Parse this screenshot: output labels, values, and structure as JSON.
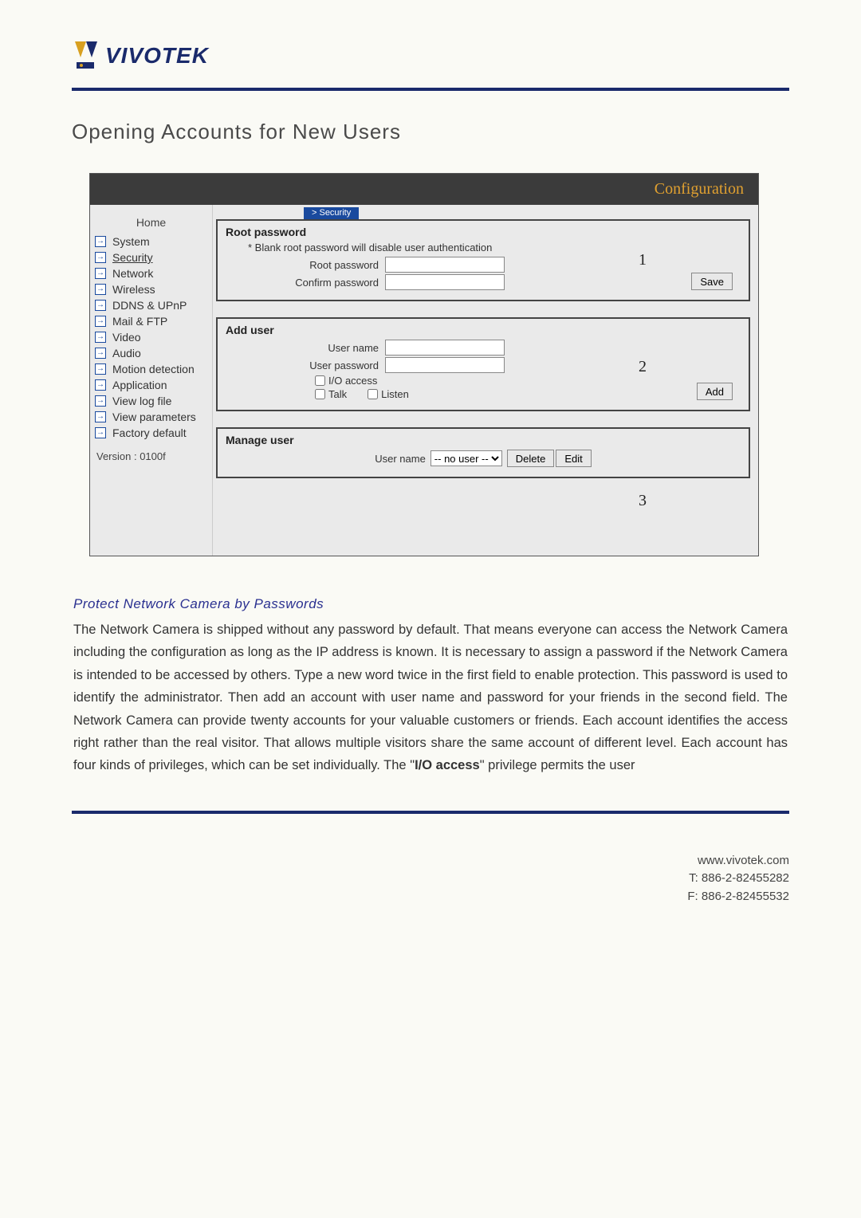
{
  "logo_text": "VIVOTEK",
  "hr_color": "#1a2a6b",
  "page_title": "Opening Accounts for New Users",
  "config_banner": "Configuration",
  "sidebar": {
    "home": "Home",
    "items": [
      {
        "label": "System"
      },
      {
        "label": "Security",
        "active": true
      },
      {
        "label": "Network"
      },
      {
        "label": "Wireless"
      },
      {
        "label": "DDNS & UPnP"
      },
      {
        "label": "Mail & FTP"
      },
      {
        "label": "Video"
      },
      {
        "label": "Audio"
      },
      {
        "label": "Motion detection"
      },
      {
        "label": "Application"
      },
      {
        "label": "View log file"
      },
      {
        "label": "View parameters"
      },
      {
        "label": "Factory default"
      }
    ],
    "version": "Version : 0100f"
  },
  "security_tab": "> Security",
  "callouts": {
    "c1": "1",
    "c2": "2",
    "c3": "3"
  },
  "panel_root": {
    "title": "Root password",
    "note": "* Blank root password will disable user authentication",
    "root_pw_label": "Root password",
    "confirm_pw_label": "Confirm password",
    "save_btn": "Save"
  },
  "panel_add": {
    "title": "Add user",
    "user_name_label": "User name",
    "user_pw_label": "User password",
    "io_access_label": "I/O access",
    "talk_label": "Talk",
    "listen_label": "Listen",
    "add_btn": "Add"
  },
  "panel_manage": {
    "title": "Manage user",
    "user_name_label": "User name",
    "select_value": "-- no user --",
    "delete_btn": "Delete",
    "edit_btn": "Edit"
  },
  "subhead": "Protect Network Camera by Passwords",
  "para_parts": {
    "p1": "The Network Camera is shipped without any password by default. That means everyone can access the Network Camera including the configuration as long as the IP address is known. It is necessary to assign a password if the Network Camera is intended to be accessed by others. Type a new word twice in the first field to enable protection. This password is used to identify the administrator. Then add an account with user name and password for your friends in the second field. The Network Camera can provide twenty accounts for your valuable customers or friends. Each account identifies the access right rather than the real visitor. That allows multiple visitors share the same account of different level. Each account has four kinds of privileges, which can be set individually. The \"",
    "bold": "I/O access",
    "p2": "\" privilege permits the user"
  },
  "footer": {
    "url": "www.vivotek.com",
    "tel": "T: 886-2-82455282",
    "fax": "F: 886-2-82455532"
  }
}
